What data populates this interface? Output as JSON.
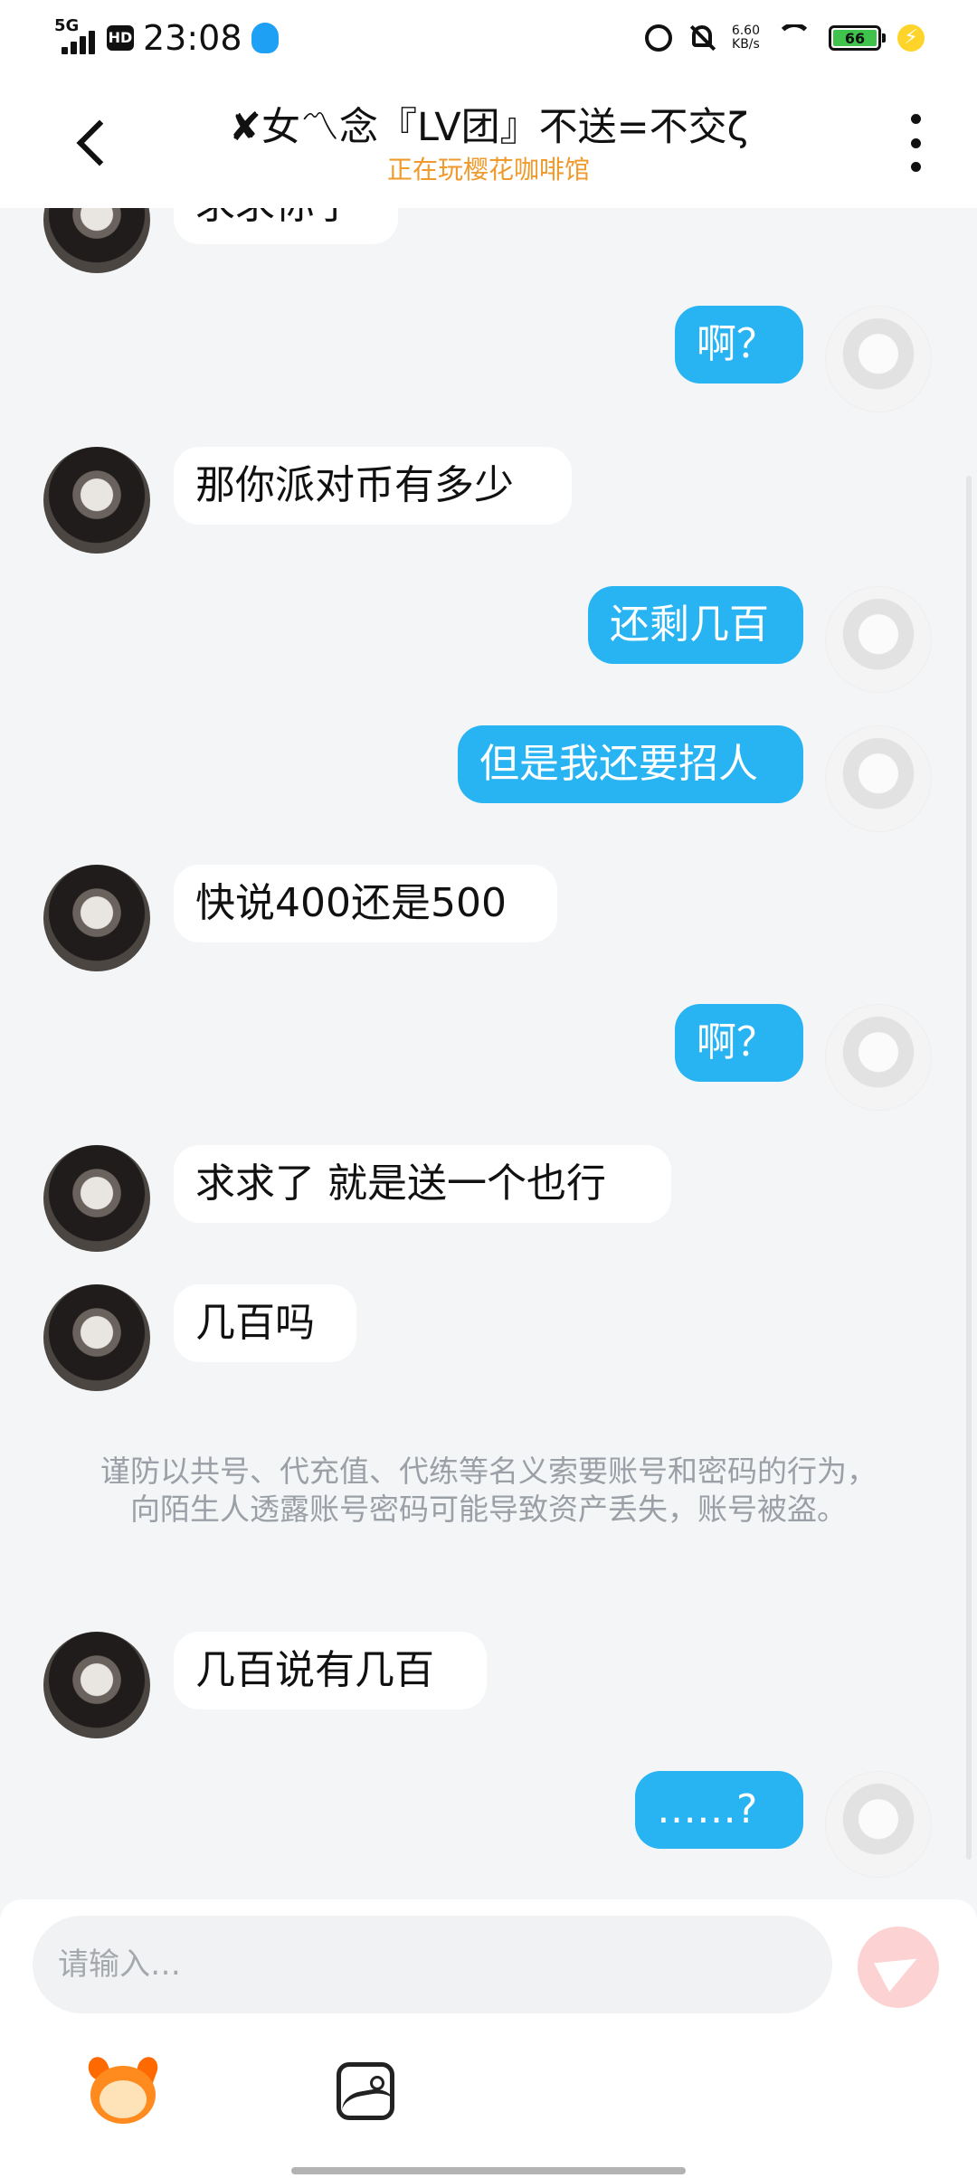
{
  "status_bar": {
    "network": "5G",
    "hd": "HD",
    "time": "23:08",
    "speed_value": "6.60",
    "speed_unit": "KB/s",
    "battery": "66",
    "icons": [
      "qq-icon",
      "alarm-icon",
      "mute-icon",
      "wifi-icon",
      "battery-icon",
      "charging-icon"
    ]
  },
  "header": {
    "title": "✘女〽念『LV团』不送=不交ζ",
    "subtitle": "正在玩樱花咖啡馆"
  },
  "messages": [
    {
      "side": "left",
      "text": "求求你了"
    },
    {
      "side": "right",
      "text": "啊？"
    },
    {
      "side": "left",
      "text": "那你派对币有多少"
    },
    {
      "side": "right",
      "text": "还剩几百"
    },
    {
      "side": "right",
      "text": "但是我还要招人"
    },
    {
      "side": "left",
      "text": "快说400还是500"
    },
    {
      "side": "right",
      "text": "啊？"
    },
    {
      "side": "left",
      "text": "求求了 就是送一个也行"
    },
    {
      "side": "left",
      "text": "几百吗"
    },
    {
      "side": "left",
      "text": "几百说有几百"
    },
    {
      "side": "right",
      "text": "……?"
    }
  ],
  "notice": "谨防以共号、代充值、代练等名义索要账号和密码的行为，向陌生人透露账号密码可能导致资产丢失，账号被盗。",
  "input": {
    "placeholder": "请输入…"
  },
  "colors": {
    "self_bubble": "#28b3f2",
    "other_bubble": "#ffffff",
    "subtitle": "#ef9a2a",
    "send_button": "#fcd2d2"
  }
}
